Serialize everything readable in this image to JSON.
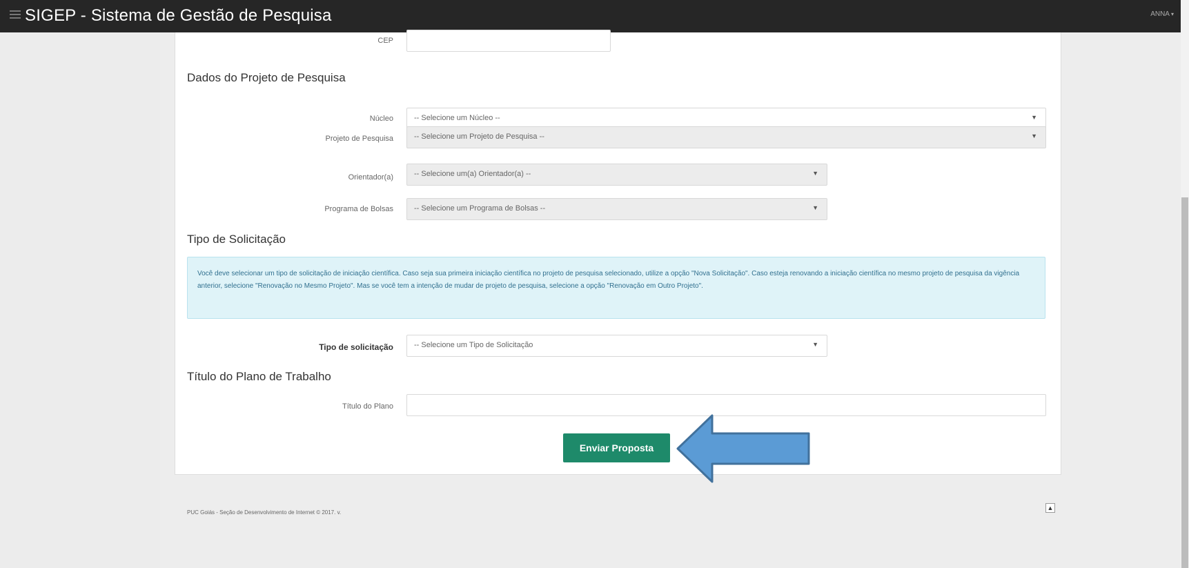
{
  "header": {
    "title": "SIGEP - Sistema de Gestão de Pesquisa",
    "user": "ANNA"
  },
  "form": {
    "cep": {
      "label": "CEP",
      "value": ""
    },
    "section_projeto": "Dados do Projeto de Pesquisa",
    "nucleo": {
      "label": "Núcleo",
      "value": "-- Selecione um Núcleo --"
    },
    "projeto": {
      "label": "Projeto de Pesquisa",
      "value": "-- Selecione um Projeto de Pesquisa --"
    },
    "orientador": {
      "label": "Orientador(a)",
      "value": "-- Selecione um(a) Orientador(a) --"
    },
    "programa": {
      "label": "Programa de Bolsas",
      "value": "-- Selecione um Programa de Bolsas --"
    },
    "section_tipo": "Tipo de Solicitação",
    "info_text": "Você deve selecionar um tipo de solicitação de iniciação científica. Caso seja sua primeira iniciação científica no projeto de pesquisa selecionado, utilize a opção \"Nova Solicitação\". Caso esteja renovando a iniciação científica no mesmo projeto de pesquisa da vigência anterior, selecione \"Renovação no Mesmo Projeto\". Mas se você tem a intenção de mudar de projeto de pesquisa, selecione a opção \"Renovação em Outro Projeto\".",
    "tipo": {
      "label": "Tipo de solicitação",
      "value": "-- Selecione um Tipo de Solicitação"
    },
    "section_titulo": "Título do Plano de Trabalho",
    "titulo": {
      "label": "Título do Plano",
      "value": ""
    },
    "submit_label": "Enviar Proposta"
  },
  "footer": {
    "text": "PUC Goiás - Seção de Desenvolvimento de Internet © 2017. v."
  },
  "colors": {
    "topbar": "#262626",
    "submit": "#1e8a6a",
    "info_bg": "#dff3f8",
    "arrow_fill": "#5b9bd5",
    "arrow_stroke": "#41719c"
  },
  "icons": {
    "menu": "hamburger-icon",
    "caret": "caret-down-icon",
    "scroll_top": "arrow-up-icon",
    "annotation": "arrow-left-icon"
  }
}
